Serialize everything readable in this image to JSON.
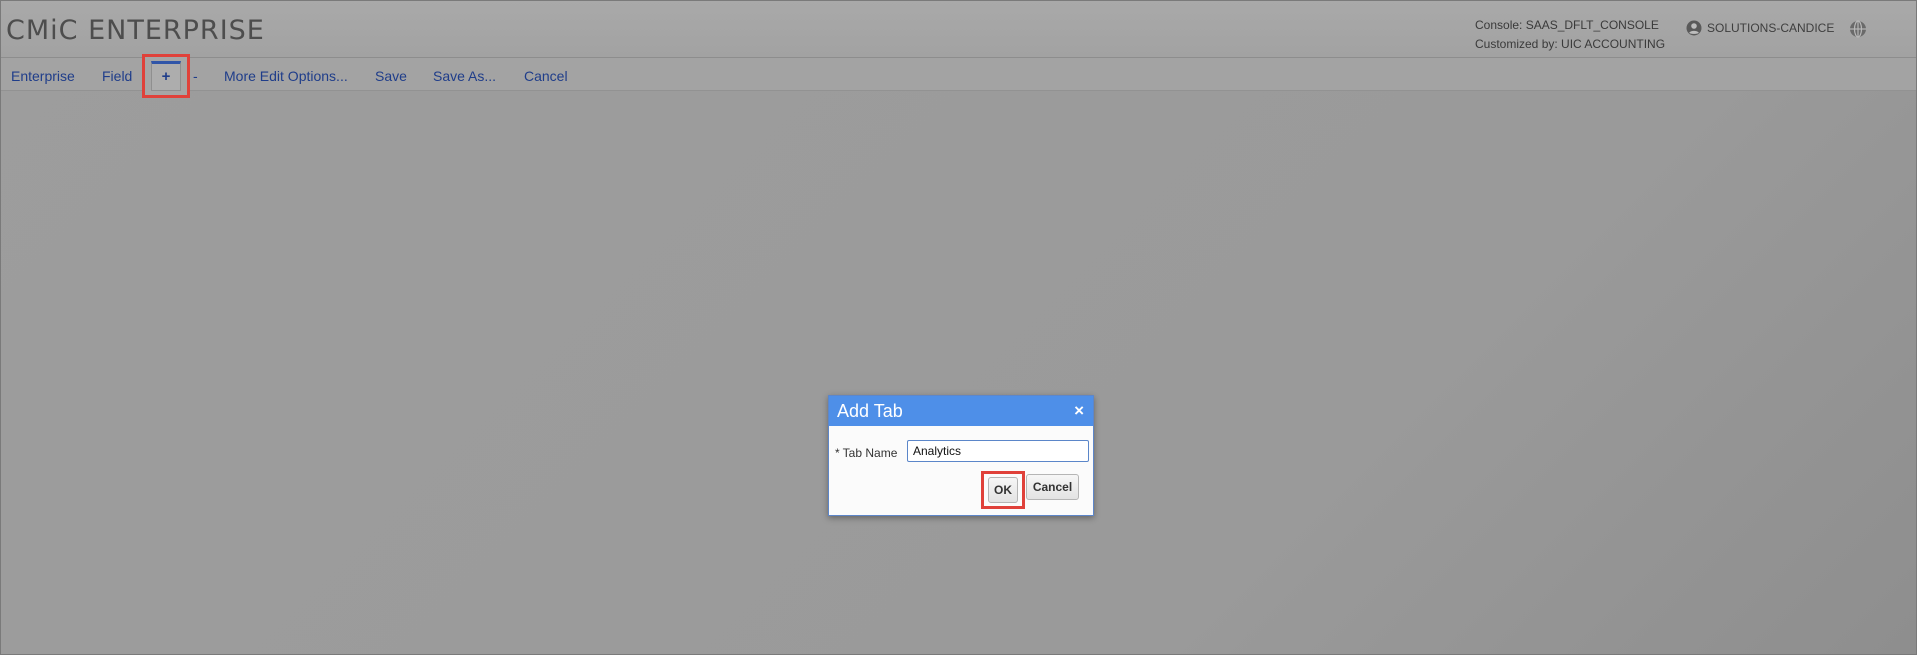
{
  "header": {
    "brand": "CMiC ENTERPRISE",
    "console": "Console: SAAS_DFLT_CONSOLE",
    "customized_by": "Customized by: UIC ACCOUNTING",
    "user": "SOLUTIONS-CANDICE",
    "icons": {
      "user": "user-circle-icon",
      "help": "globe-help-icon"
    }
  },
  "toolbar": {
    "enterprise": "Enterprise",
    "field": "Field",
    "add": "+",
    "remove": "-",
    "more_edit_options": "More Edit Options...",
    "save": "Save",
    "save_as": "Save As...",
    "cancel": "Cancel"
  },
  "dialog": {
    "title": "Add Tab",
    "close": "×",
    "required_marker": "*",
    "tab_name_label": "Tab Name",
    "tab_name_value": "Analytics",
    "ok": "OK",
    "cancel": "Cancel"
  },
  "colors": {
    "dialog_header": "#4e8fe8",
    "highlight": "#e0413a",
    "link": "#1f3d8a"
  }
}
